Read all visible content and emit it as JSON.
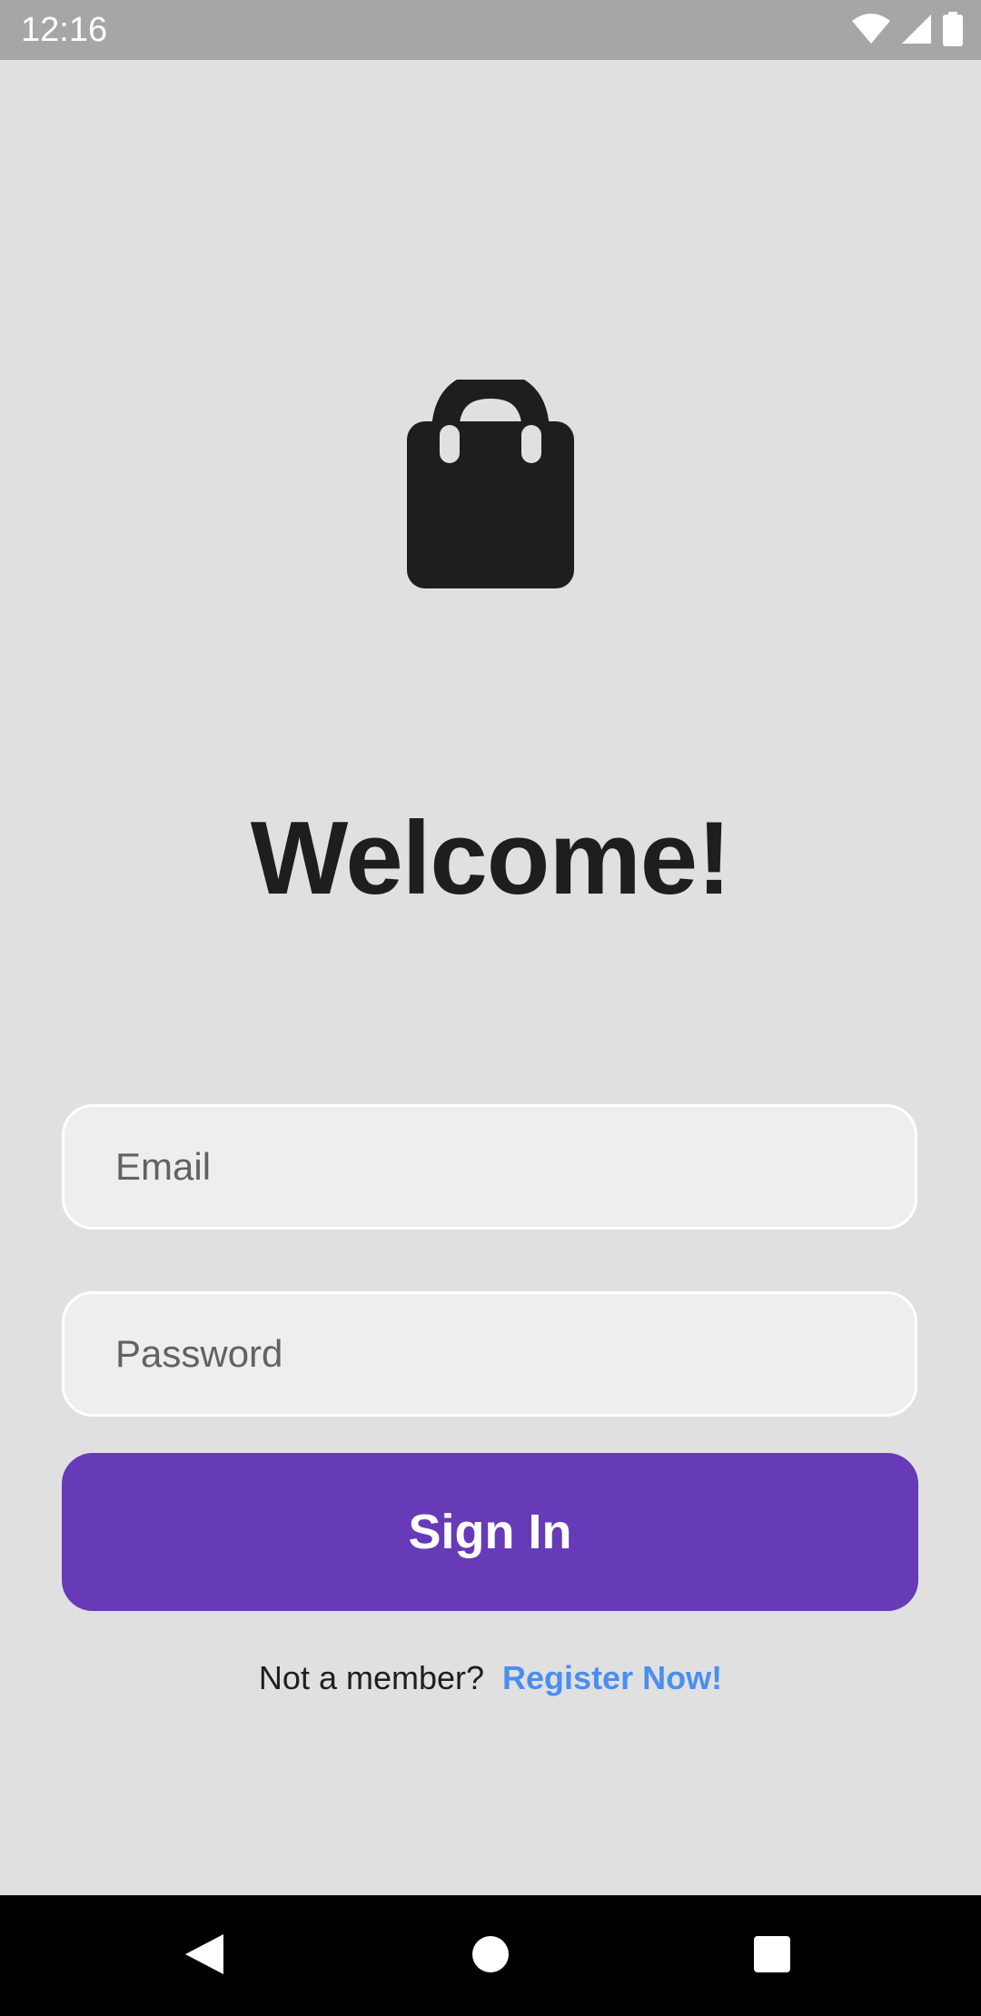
{
  "status_bar": {
    "time": "12:16",
    "icons": [
      "wifi-icon",
      "cellular-signal-icon",
      "battery-icon"
    ]
  },
  "logo": {
    "icon": "shopping-bag-icon"
  },
  "title": "Welcome!",
  "form": {
    "email_placeholder": "Email",
    "password_placeholder": "Password",
    "sign_in_label": "Sign In"
  },
  "register": {
    "prompt": "Not a member?",
    "link_label": "Register Now!"
  },
  "navigation": {
    "buttons": [
      "back-icon",
      "home-icon",
      "recents-icon"
    ]
  },
  "colors": {
    "background": "#e0e0e0",
    "primary": "#673ab7",
    "link": "#4a8ef0",
    "text": "#1e1e1e",
    "field_background": "#eeeeee",
    "status_bar": "#a6a6a6"
  }
}
